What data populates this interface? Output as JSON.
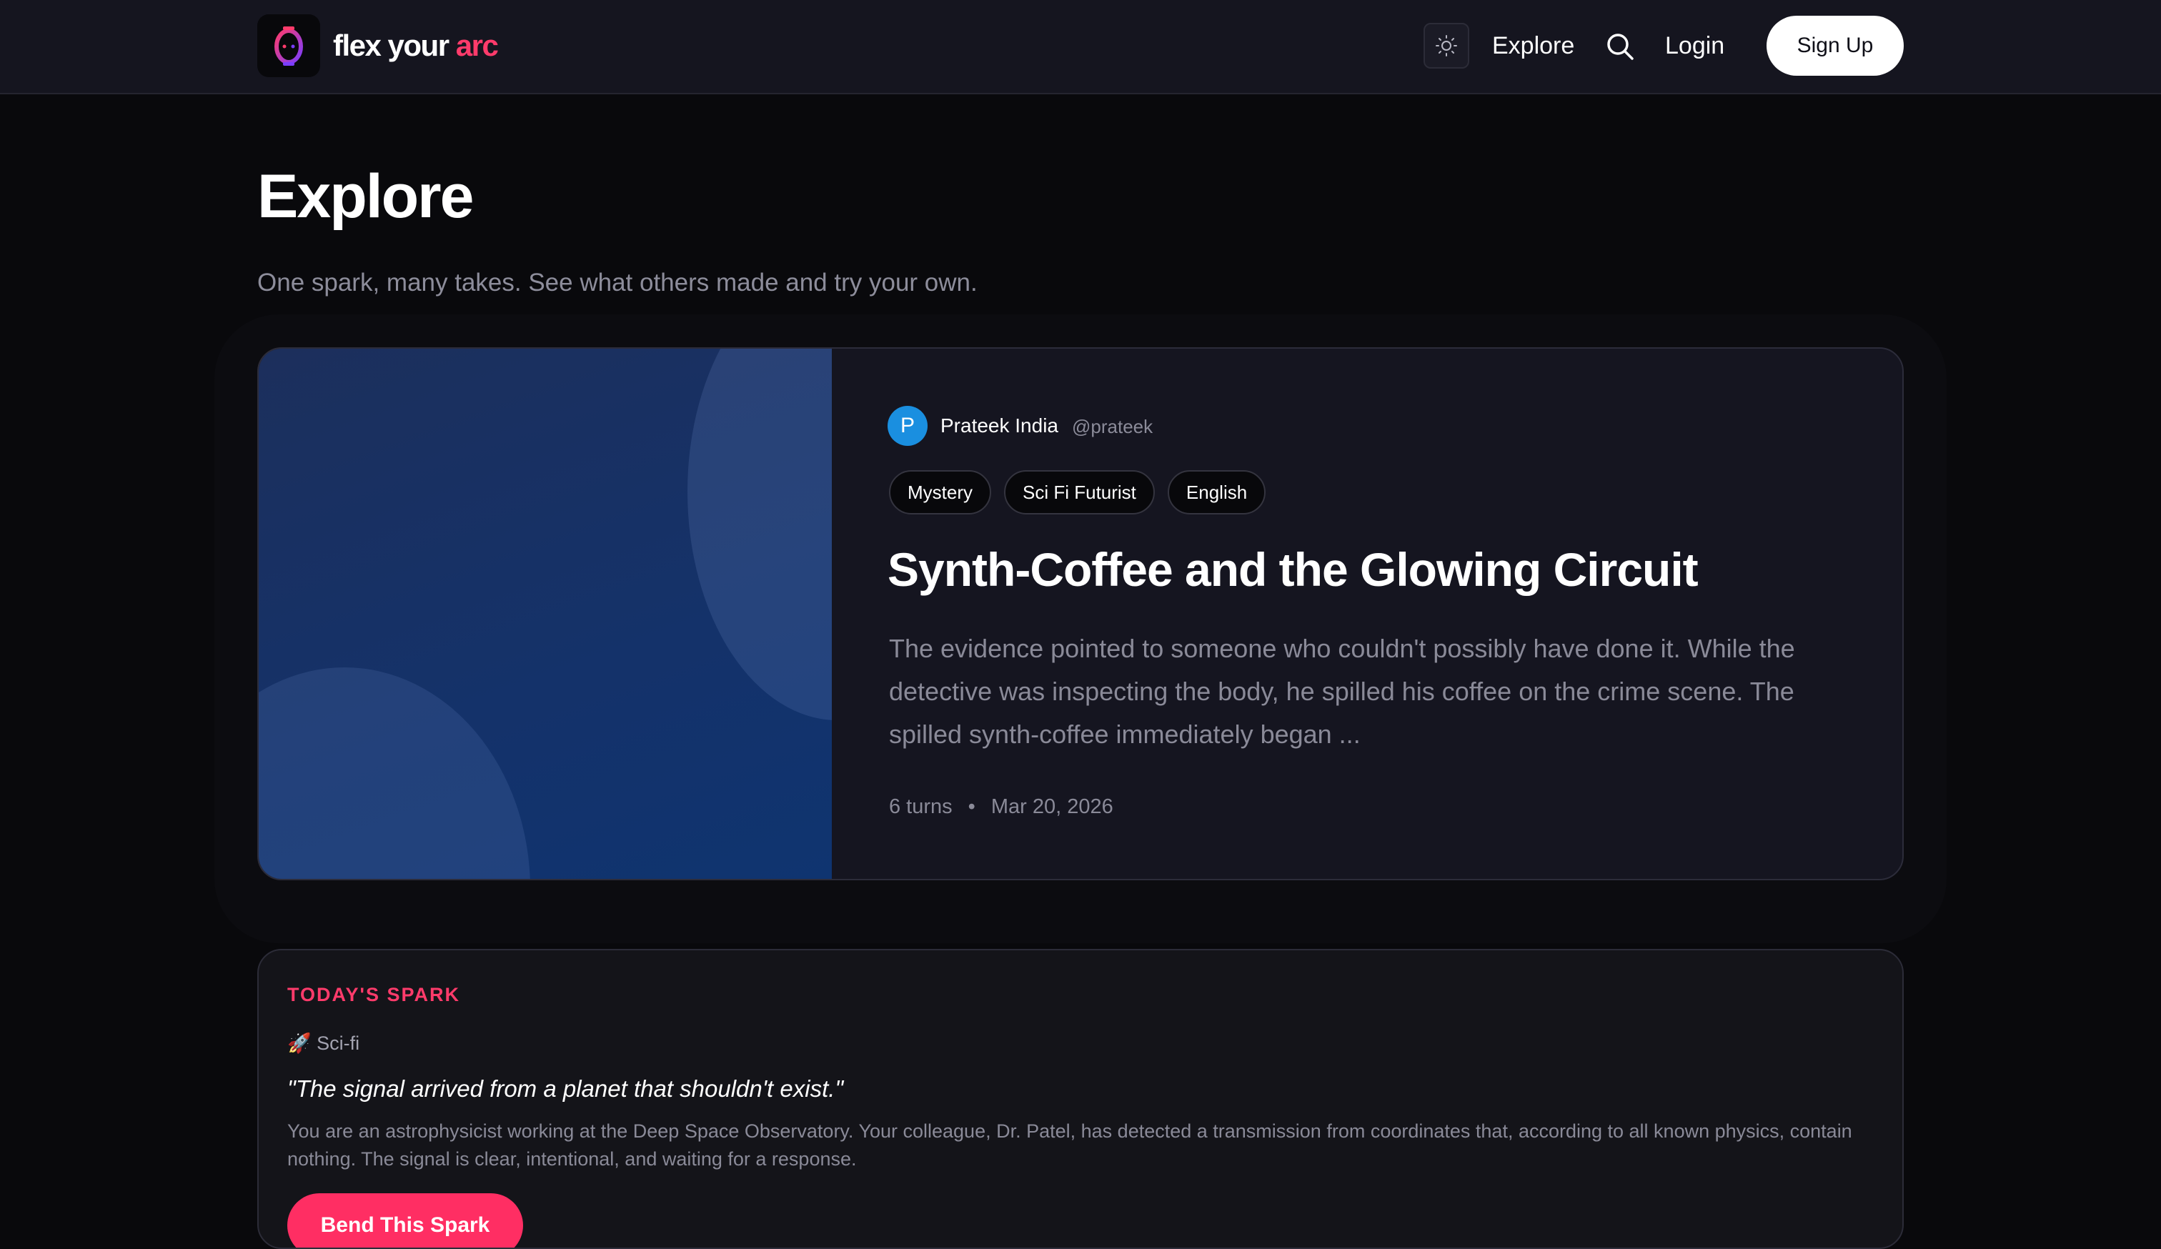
{
  "nav": {
    "brand_part1": "flex your",
    "brand_part2": "arc",
    "explore": "Explore",
    "login": "Login",
    "signup": "Sign Up",
    "brand_accent": "#ff3b6b"
  },
  "header": {
    "title": "Explore",
    "subtitle": "One spark, many takes. See what others made and try your own."
  },
  "featured": {
    "author_initial": "P",
    "author_name": "Prateek India",
    "author_handle": "@prateek",
    "tags": [
      "Mystery",
      "Sci Fi Futurist",
      "English"
    ],
    "title": "Synth-Coffee and the Glowing Circuit",
    "excerpt": "The evidence pointed to someone who couldn't possibly have done it. While the detective was inspecting the body, he spilled his coffee on the crime scene. The spilled synth-coffee immediately began ...",
    "turns": "6 turns",
    "separator": "•",
    "date": "Mar 20, 2026"
  },
  "spark": {
    "label": "TODAY'S SPARK",
    "genre": "🚀 Sci-fi",
    "quote": "\"The signal arrived from a planet that shouldn't exist.\"",
    "description": "You are an astrophysicist working at the Deep Space Observatory. Your colleague, Dr. Patel, has detected a transmission from coordinates that, according to all known physics, contain nothing. The signal is clear, intentional, and waiting for a response.",
    "button": "Bend This Spark"
  }
}
